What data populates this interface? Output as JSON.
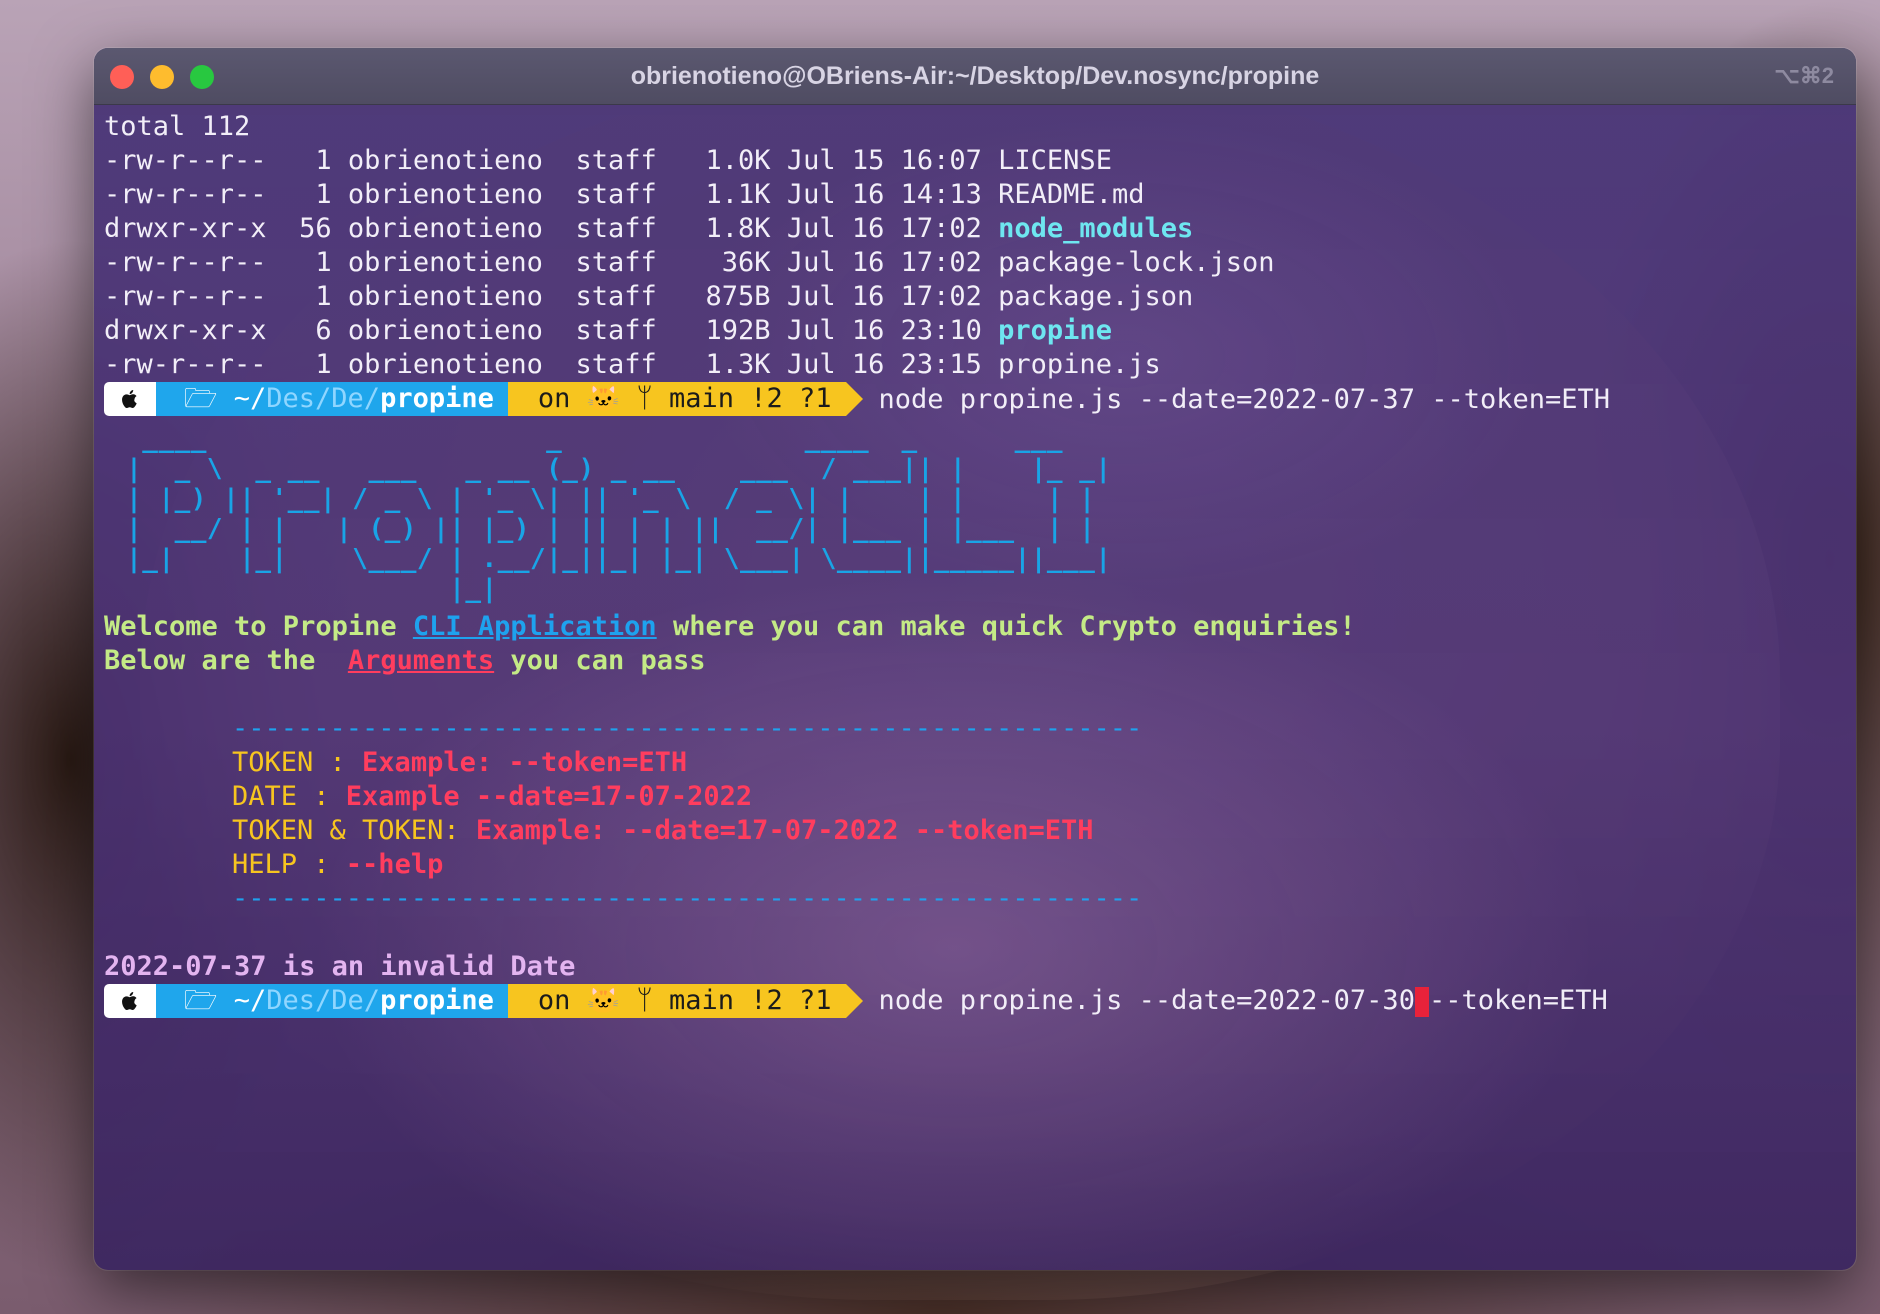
{
  "window": {
    "title": "obrienotieno@OBriens-Air:~/Desktop/Dev.nosync/propine",
    "shortcut": "⌥⌘2"
  },
  "listing": {
    "total": "total 112",
    "rows": [
      {
        "perms": "-rw-r--r--",
        "links": " 1",
        "owner": "obrienotieno",
        "group": "staff",
        "size": "1.0K",
        "date": "Jul 15 16:07",
        "name": "LICENSE",
        "is_dir": false
      },
      {
        "perms": "-rw-r--r--",
        "links": " 1",
        "owner": "obrienotieno",
        "group": "staff",
        "size": "1.1K",
        "date": "Jul 16 14:13",
        "name": "README.md",
        "is_dir": false
      },
      {
        "perms": "drwxr-xr-x",
        "links": "56",
        "owner": "obrienotieno",
        "group": "staff",
        "size": "1.8K",
        "date": "Jul 16 17:02",
        "name": "node_modules",
        "is_dir": true
      },
      {
        "perms": "-rw-r--r--",
        "links": " 1",
        "owner": "obrienotieno",
        "group": "staff",
        "size": " 36K",
        "date": "Jul 16 17:02",
        "name": "package-lock.json",
        "is_dir": false
      },
      {
        "perms": "-rw-r--r--",
        "links": " 1",
        "owner": "obrienotieno",
        "group": "staff",
        "size": "875B",
        "date": "Jul 16 17:02",
        "name": "package.json",
        "is_dir": false
      },
      {
        "perms": "drwxr-xr-x",
        "links": " 6",
        "owner": "obrienotieno",
        "group": "staff",
        "size": "192B",
        "date": "Jul 16 23:10",
        "name": "propine",
        "is_dir": true
      },
      {
        "perms": "-rw-r--r--",
        "links": " 1",
        "owner": "obrienotieno",
        "group": "staff",
        "size": "1.3K",
        "date": "Jul 16 23:15",
        "name": "propine.js",
        "is_dir": false
      }
    ]
  },
  "prompt": {
    "path_home": "~/",
    "path_dim": "Des/De/",
    "path_bold": "propine",
    "git": "on 🐱 ᛘ main !2 ?1"
  },
  "commands": {
    "first": "node propine.js --date=2022-07-37 --token=ETH",
    "second_before_cursor": "node propine.js --date=2022-07-30",
    "second_after_cursor": "--token=ETH"
  },
  "banner_art": "  ____                     _               ____  _      ___ \n |  _ \\  _ __   ___   _ __ (_) _ __    ___  / ___|| |    |_ _|\n | |_) || '__| / _ \\ | '_ \\| || '_ \\  / _ \\| |    | |     | | \n |  __/ | |   | (_) || |_) | || | | ||  __/| |___ | |___  | | \n |_|    |_|    \\___/ | .__/|_||_| |_| \\___| \\____||_____||___|\n                     |_|                                      ",
  "welcome": {
    "line1_a": "Welcome to Propine ",
    "line1_link": "CLI Application",
    "line1_b": " where you can make quick Crypto enquiries!",
    "line2_a": "Below are the  ",
    "line2_link": "Arguments",
    "line2_b": " you can pass"
  },
  "help": {
    "dashes": "--------------------------------------------------------",
    "items": [
      {
        "label": "TOKEN : ",
        "example": "Example: --token=ETH"
      },
      {
        "label": "DATE : ",
        "example": "Example --date=17-07-2022"
      },
      {
        "label": "TOKEN & TOKEN: ",
        "example": "Example: --date=17-07-2022 --token=ETH"
      },
      {
        "label": "HELP : ",
        "example": "--help"
      }
    ]
  },
  "error_message": "2022-07-37 is an invalid Date",
  "colors": {
    "terminal_bg": "#4c3474",
    "prompt_path": "#1fa6ec",
    "prompt_git": "#f7c51f",
    "directory": "#6ee6f0",
    "banner": "#19a4e6",
    "welcome": "#c4ea86",
    "argument_example": "#ff3d5e",
    "cursor": "#e8223a"
  }
}
